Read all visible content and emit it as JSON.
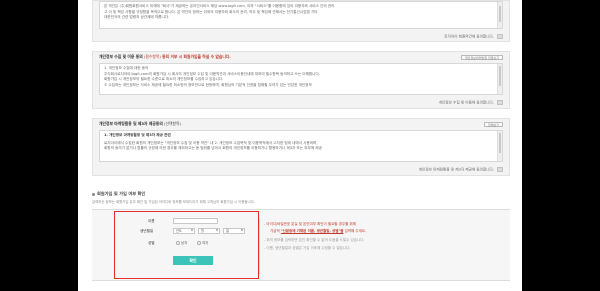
{
  "terms": {
    "lines": [
      "본 약관은 (주)회원회원서비스 미래에 \"회사\"가 제공하는 온라인서비스 해당 www.logit.com, 이하 \"서비스\"를 이용함에 있어 이용자와 서비스 간의 권리",
      "고 이 및 책임 사항을 규정함을 목적으로 합니다. 본 약관이 정하는 이외의 이용자와 회사의 권리, 의무 및 책임에 관해서는 전기통신사업법 기타",
      "대한민국의 관련 법령과 상관례에 따릅니다."
    ],
    "agree_label": "로지아이 회원약관에 동의합니다."
  },
  "privacy": {
    "title": "개인정보 수집 및 이용 동의",
    "required": "(필수항목)",
    "hint": "동의 거부 시 회원가입을 하실 수 없습니다.",
    "button": "개인정보처리방침 전문보기",
    "lines": [
      "1. 개인정보 수집에 대한 동의",
      "주식회사로지아이(logit.com의 회원가입 시 회사의 개인정보 수집 및 이용약관과 서비스이용안내에 대하여 필수항목 동의하고 쓰는 이해합니다.",
      "회원가입 시 개인정보의 필요한 수준으로 최소의 개인정보를 수집하고 있습니다.",
      "② 수집하는 개인정보는 서비스 제공에 필요한 최소한의 정보만으로 한정하며, 회원님의 기본적 인권을 침해할 우려가 있는 민감한 개인정보"
    ],
    "agree_label": "개인정보 수집 및 이용에 동의합니다."
  },
  "marketing": {
    "title": "개인정보 마케팅활용 및 제3자 제공동의",
    "optional": "(선택항목)",
    "button": "전체보기",
    "heading": "1. 개인정보 마케팅활용 및 제3자 제공 관련",
    "lines": [
      "로지아이에서 수집한 회원의 개인정보는 \"개인정보 수집 및 이용 약관\" 내 2. 개인정보 수집목적 및 이용목적에서 고지한 범위 내에서 사용하며,",
      "회원의 동의가 없거나 법률의 규정에 의한 경우를 제외하고는 동 범위를 넘어서 회원의 개인정보를 이용하거나 활용하거나 제3자 또는 외부에 제공"
    ],
    "agree_label": "개인정보 마케팅활용 및 제3자 제공에 동의합니다."
  },
  "verify": {
    "title": "회원가입 및 가입 여부 확인",
    "desc": "입력하신 정보는 회원가입 유무 확인 및 가입된 아이디와 정보를 보여드리기 위해 고객님의 회원가입 시 이용됩니다.",
    "name_label": "이름",
    "birth_label": "생년월일",
    "birth_year": "년도",
    "birth_month": "월",
    "birth_day": "일",
    "gender_label": "성별",
    "gender_male": "남자",
    "gender_female": "여자",
    "confirm_label": "확인",
    "note1a": "- 아이디/비밀번호 분실 및 본인여부 확인이 필요할 경우를 위해",
    "note1b_pre": "가급적 ",
    "note1b_u": "\"신분증에 기재된 이름, 생년월일, 성별\"을",
    "note1b_post": " 입력해 주세요.",
    "note2": "- 위의 정보를 입력하면 본인 확인할 수 없어 도움을 드릴수 있습니다.",
    "note3": "- 이름, 생년월일과 성별은 가입 이후에 수정할 수 없습니다."
  },
  "colors": {
    "accent": "#3cc4b8",
    "highlight_border": "#e0302e",
    "warning_text": "#c0392b"
  }
}
